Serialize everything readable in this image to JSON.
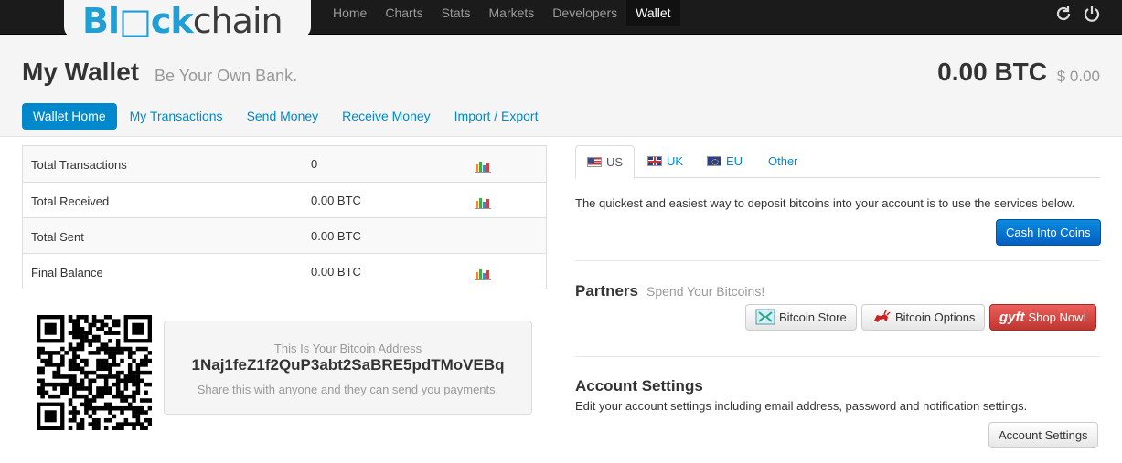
{
  "logo": {
    "part1": "Bl",
    "part2": "ck",
    "part3": "chain"
  },
  "nav": {
    "items": [
      "Home",
      "Charts",
      "Stats",
      "Markets",
      "Developers",
      "Wallet"
    ],
    "active_index": 5
  },
  "icons": {
    "refresh": "refresh-icon",
    "logout": "power-icon"
  },
  "header": {
    "title": "My Wallet",
    "subtitle": "Be Your Own Bank.",
    "balance_btc": "0.00 BTC",
    "balance_usd": "$ 0.00"
  },
  "tabs": [
    "Wallet Home",
    "My Transactions",
    "Send Money",
    "Receive Money",
    "Import / Export"
  ],
  "stats": [
    {
      "label": "Total Transactions",
      "value": "0",
      "has_chart": true
    },
    {
      "label": "Total Received",
      "value": "0.00 BTC",
      "has_chart": true
    },
    {
      "label": "Total Sent",
      "value": "0.00 BTC",
      "has_chart": false
    },
    {
      "label": "Final Balance",
      "value": "0.00 BTC",
      "has_chart": true
    }
  ],
  "address": {
    "label": "This Is Your Bitcoin Address",
    "value": "1Naj1feZ1f2QuP3abt2SaBRE5pdTMoVEBq",
    "note": "Share this with anyone and they can send you payments."
  },
  "region_tabs": [
    "US",
    "UK",
    "EU",
    "Other"
  ],
  "deposit": {
    "text": "The quickest and easiest way to deposit bitcoins into your account is to use the services below.",
    "button": "Cash Into Coins"
  },
  "partners": {
    "title": "Partners",
    "subtitle": "Spend Your Bitcoins!",
    "buttons": [
      "Bitcoin Store",
      "Bitcoin Options",
      "Shop Now!"
    ],
    "gyft_logo": "gyft"
  },
  "account": {
    "title": "Account Settings",
    "desc": "Edit your account settings including email address, password and notification settings.",
    "button": "Account Settings"
  },
  "colors": {
    "accent": "#0088cc",
    "danger": "#da4f49",
    "logo_blue": "#1f9fd6"
  }
}
